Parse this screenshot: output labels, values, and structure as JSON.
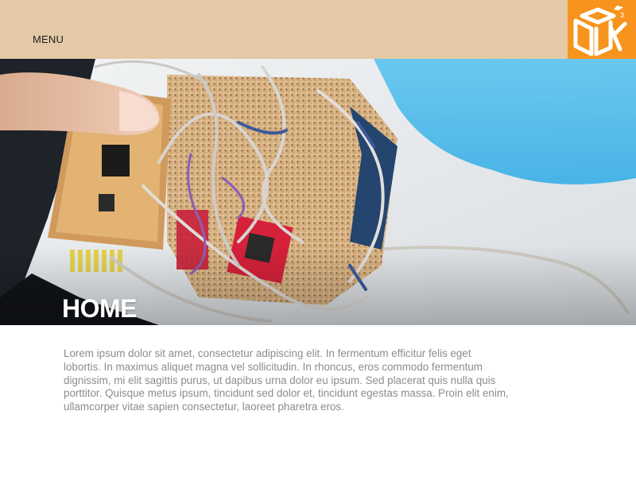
{
  "header": {
    "menu_label": "MENU",
    "logo_icon": "cube-logo-icon",
    "background_color": "#e4c9a6",
    "logo_background_color": "#f7941d"
  },
  "hero": {
    "title": "HOME",
    "image_alt": "Hand holding a perfboard electronics prototype with wires and red breakout boards"
  },
  "content": {
    "paragraph": "Lorem ipsum dolor sit amet, consectetur adipiscing elit. In fermentum efficitur felis eget lobortis. In maximus aliquet magna vel sollicitudin. In rhoncus, eros commodo fermentum dignissim, mi elit sagittis purus, ut dapibus urna dolor eu ipsum. Sed placerat quis nulla quis porttitor. Quisque metus ipsum, tincidunt sed dolor et, tincidunt egestas massa. Proin elit enim, ullamcorper vitae sapien consectetur, laoreet pharetra eros."
  }
}
